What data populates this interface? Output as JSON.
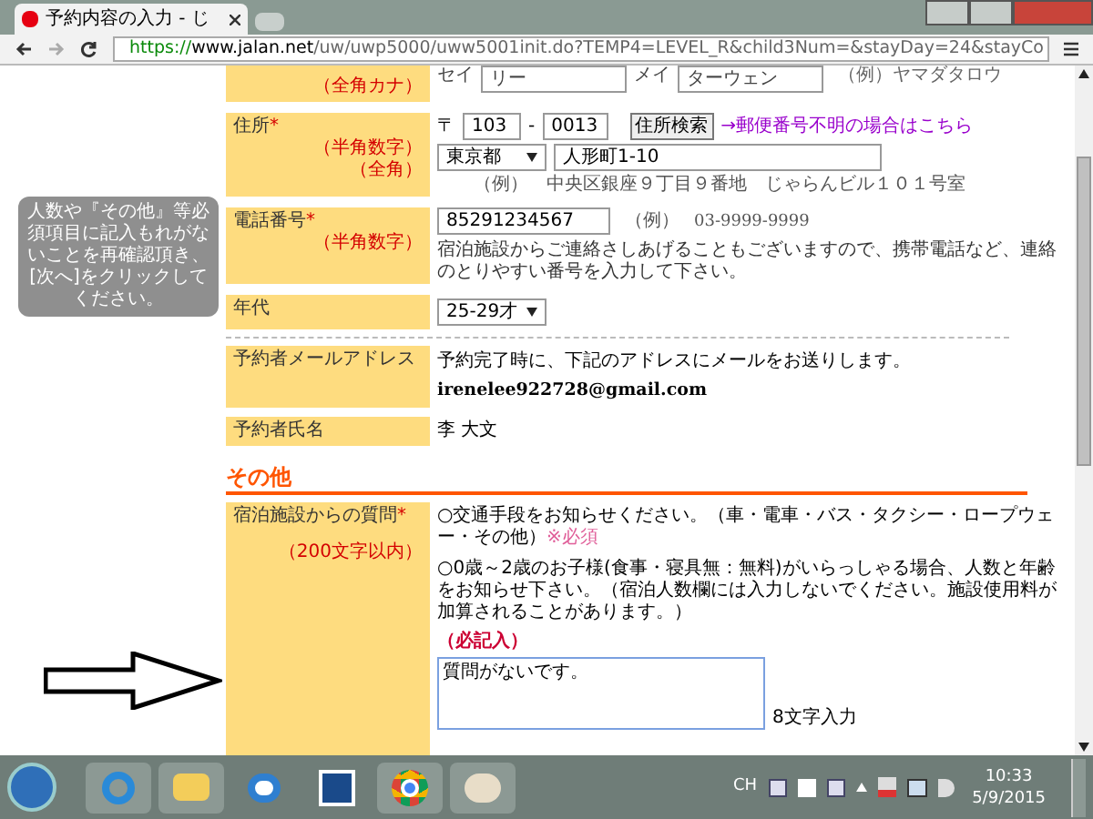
{
  "browser": {
    "tab_title": "予約内容の入力 - じ",
    "url": {
      "scheme": "https://",
      "host": "www.jalan.net",
      "path": "/uw/uwp5000/uww5001init.do?TEMP4=LEVEL_R&child3Num=&stayDay=24&stayCo"
    }
  },
  "kana_row": {
    "note": "（全角カナ）",
    "sei_label": "セイ",
    "sei_value": "リー",
    "mei_label": "メイ",
    "mei_value": "ターウェン",
    "example": "（例）ヤマダタロウ"
  },
  "address_row": {
    "label": "住所",
    "required": "*",
    "notes": [
      "（半角数字）",
      "（全角）"
    ],
    "postal_mark": "〒",
    "zip1": "103",
    "dash": "-",
    "zip2": "0013",
    "search_button": "住所検索",
    "link": "→郵便番号不明の場合はこちら",
    "prefecture": "東京都",
    "address": "人形町1-10",
    "example": "（例）　中央区銀座９丁目９番地　じゃらんビル１０１号室"
  },
  "phone_row": {
    "label": "電話番号",
    "required": "*",
    "note": "（半角数字）",
    "value": "85291234567",
    "example_prefix": "（例）",
    "example": "03-9999-9999",
    "help": "宿泊施設からご連絡さしあげることもございますので、携帯電話など、連絡のとりやすい番号を入力して下さい。"
  },
  "age_row": {
    "label": "年代",
    "value": "25-29才"
  },
  "email_row": {
    "label": "予約者メールアドレス",
    "text": "予約完了時に、下記のアドレスにメールをお送りします。",
    "email": "irenelee922728@gmail.com"
  },
  "name_row": {
    "label": "予約者氏名",
    "value": "李 大文"
  },
  "section_title": "その他",
  "question_row": {
    "label": "宿泊施設からの質問",
    "required": "*",
    "note": "（200文字以内）",
    "q1": "○交通手段をお知らせください。（車・電車・バス・タクシー・ロープウェー・その他）",
    "q1_required": "※必須",
    "q2": "○0歳～2歳のお子様(食事・寝具無：無料)がいらっしゃる場合、人数と年齢をお知らせ下さい。（宿泊人数欄には入力しないでください。施設使用料が加算されることがあります。）",
    "must": "（必記入）",
    "answer": "質問がないです。",
    "count": "8文字入力"
  },
  "tooltip": "人数や『その他』等必須項目に記入もれがないことを再確認頂き、[次へ]をクリックしてください。",
  "taskbar": {
    "language": "CH",
    "time": "10:33",
    "date": "5/9/2015"
  }
}
